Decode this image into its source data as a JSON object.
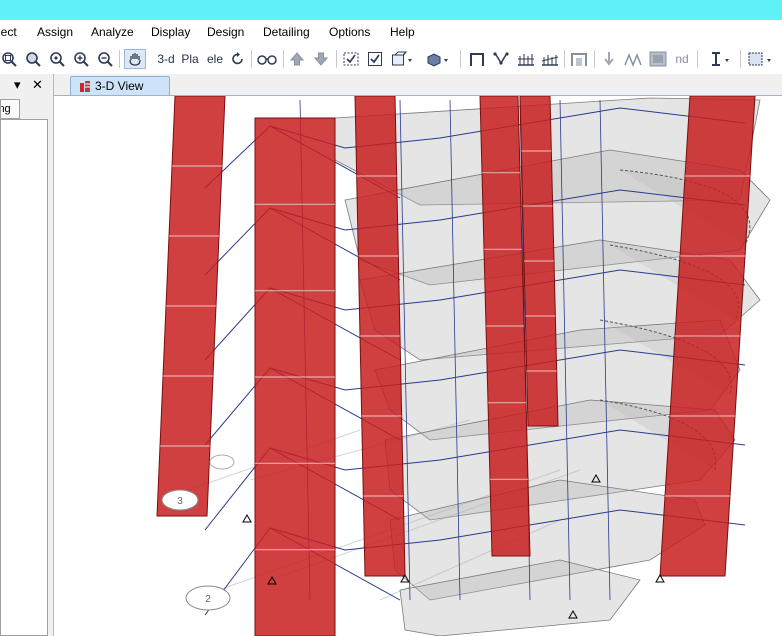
{
  "menu": {
    "items": [
      "lect",
      "Assign",
      "Analyze",
      "Display",
      "Design",
      "Detailing",
      "Options",
      "Help"
    ]
  },
  "toolbar": {
    "view_3d": "3-d",
    "view_plan": "Pla",
    "view_elev": "ele",
    "nd_label": "nd"
  },
  "left_panel": {
    "tab_label": "ing",
    "close_glyph": "✕",
    "dropdown_glyph": "▾"
  },
  "view": {
    "tab_title": "3-D View"
  },
  "grid_bubbles": [
    "3",
    "2"
  ],
  "colors": {
    "title_bar": "#5ef2f8",
    "column_red": "#c81e1e",
    "beam_blue": "#2a3a8c",
    "slab_gray": "#b4b4b4",
    "tab_active": "#cde3f7"
  }
}
